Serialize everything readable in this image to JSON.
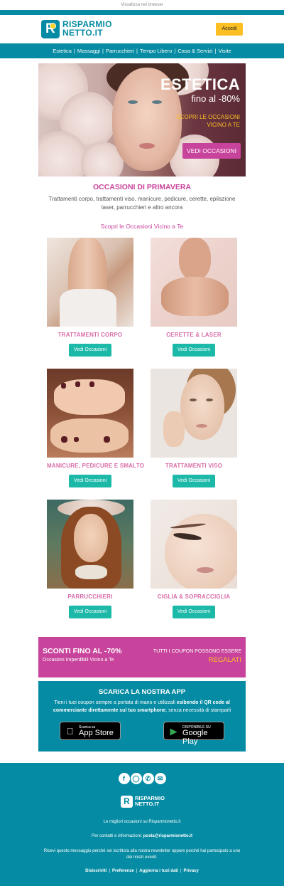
{
  "top_link": "Visualizza nel browser",
  "header": {
    "logo_line1": "RISPARMIO",
    "logo_line2": "NETTO.IT",
    "login_label": "Accedi"
  },
  "nav": [
    "Estetica",
    "Massaggi",
    "Parrucchieri",
    "Tempo Libero",
    "Casa & Servizi",
    "Visite"
  ],
  "hero": {
    "title": "ESTETICA",
    "subtitle": "fino al -80%",
    "tagline_line1": "SCOPRI LE OCCASIONI",
    "tagline_line2": "VICINO A TE",
    "button": "VEDI OCCASIONI"
  },
  "section": {
    "title": "OCCASIONI DI PRIMAVERA",
    "description": "Trattamenti corpo, trattamenti viso, manicure, pedicure, cerette, epilazione laser, parrucchieri e altro ancora",
    "link": "Scopri le Occasioni Vicino a Te"
  },
  "cards": [
    {
      "title": "TRATTAMENTI CORPO",
      "button": "Vedi Occasioni"
    },
    {
      "title": "CERETTE & LASER",
      "button": "Vedi Occasioni"
    },
    {
      "title": "MANICURE, PEDICURE E SMALTO",
      "button": "Vedi Occasioni"
    },
    {
      "title": "TRATTAMENTI VISO",
      "button": "Vedi Occasioni"
    },
    {
      "title": "PARRUCCHIERI",
      "button": "Vedi Occasioni"
    },
    {
      "title": "CIGLIA & SOPRACCIGLIA",
      "button": "Vedi Occasioni"
    }
  ],
  "promo": {
    "left_title": "SCONTI FINO AL -70%",
    "left_sub": "Occasioni Imperdibili Vicino a Te",
    "right_line1": "TUTTI I COUPON POSSONO ESSERE",
    "right_line2": "REGALATI"
  },
  "app": {
    "title": "SCARICA LA NOSTRA APP",
    "desc_part1": "Tieni i tuoi coupon sempre a portata di mano e utilizzali ",
    "desc_bold": "esibendo il QR code al commerciante direttamente sul tuo smartphone",
    "desc_part2": ", senza necessità di stamparli",
    "appstore_small": "Scarica su",
    "appstore_big": "App Store",
    "googleplay_small": "DISPONIBILE SU",
    "googleplay_big": "Google Play"
  },
  "footer": {
    "social_icons": [
      "facebook-icon",
      "instagram-icon",
      "whatsapp-icon",
      "email-icon"
    ],
    "logo_line1": "RISPARMIO",
    "logo_line2": "NETTO.IT",
    "line1": "Le migliori occasioni su Risparmionetto.it",
    "line2_prefix": "Per contatti e informazioni: ",
    "line2_email": "posta@risparmionetto.it",
    "line3": "Ricevi questo messaggio perché sei iscritto/a alla nostra newsletter oppure perché hai partecipato a uno dei nostri eventi.",
    "links": [
      "Disiscriviti",
      "Preferenze",
      "Aggiorna i tuoi dati",
      "Privacy"
    ]
  },
  "colors": {
    "teal": "#058ba3",
    "pink": "#c8449c",
    "yellow": "#fbbf24",
    "button_green": "#1cb8a8"
  }
}
